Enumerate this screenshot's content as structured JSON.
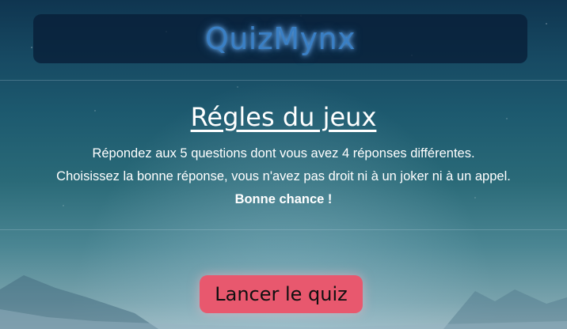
{
  "header": {
    "title": "QuizMynx"
  },
  "rules": {
    "heading": "Régles du jeux",
    "line1": "Répondez aux 5 questions dont vous avez 4 réponses différentes.",
    "line2": "Choisissez la bonne réponse, vous n'avez pas droit ni à un joker ni à un appel.",
    "line3": "Bonne chance !"
  },
  "actions": {
    "start_label": "Lancer le quiz"
  },
  "colors": {
    "header_bg": "#081e37",
    "title_color": "#3a7fc4",
    "button_bg": "#e8586e"
  }
}
